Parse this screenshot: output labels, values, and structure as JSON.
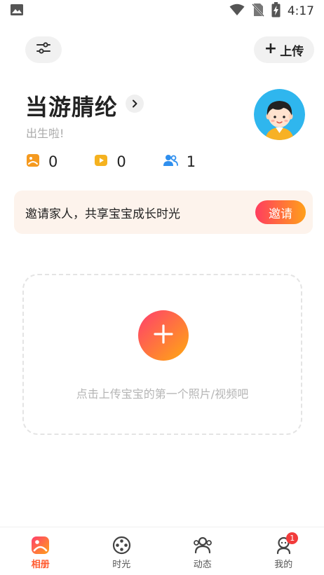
{
  "status_bar": {
    "time": "4:17",
    "icons": [
      "image-notification-icon",
      "wifi-icon",
      "no-sim-icon",
      "battery-charging-icon"
    ]
  },
  "header": {
    "filter_icon": "sliders-icon",
    "upload_label": "上传"
  },
  "profile": {
    "name": "当游腈纶",
    "status": "出生啦!",
    "avatar_icon": "child-avatar-icon",
    "stats": [
      {
        "icon": "photo-icon",
        "count": "0",
        "color": "#f59a1f"
      },
      {
        "icon": "video-icon",
        "count": "0",
        "color": "#f5b21f"
      },
      {
        "icon": "family-members-icon",
        "count": "1",
        "color": "#2f8fee"
      }
    ]
  },
  "invite": {
    "text": "邀请家人，共享宝宝成长时光",
    "button": "邀请"
  },
  "empty_state": {
    "hint": "点击上传宝宝的第一个照片/视频吧"
  },
  "bottom_nav": {
    "items": [
      {
        "label": "相册",
        "icon": "album-icon",
        "active": true
      },
      {
        "label": "时光",
        "icon": "film-reel-icon",
        "active": false
      },
      {
        "label": "动态",
        "icon": "people-icon",
        "active": false
      },
      {
        "label": "我的",
        "icon": "profile-icon",
        "active": false,
        "badge": "1"
      }
    ]
  },
  "colors": {
    "accent_start": "#ff3d5f",
    "accent_end": "#ffa01a",
    "banner_bg": "#fdf3ec",
    "badge": "#f23b3b"
  }
}
